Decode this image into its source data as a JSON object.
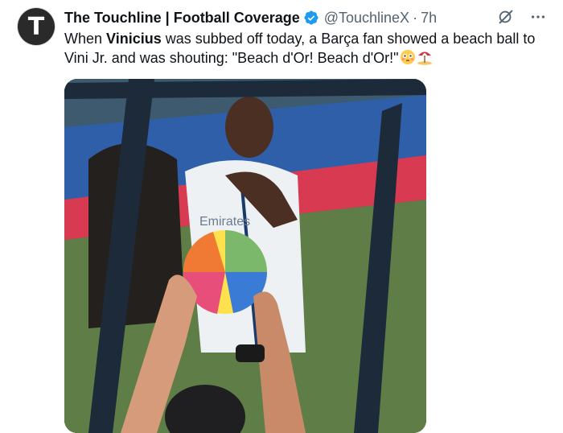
{
  "account": {
    "display_name": "The Touchline | Football Coverage",
    "handle": "@TouchlineX",
    "separator": "·",
    "time": "7h",
    "avatar_letter": "T"
  },
  "post": {
    "text_1": "When ",
    "bold_1": "Vinicius",
    "text_2": " was subbed off today, a Barça fan showed a beach ball to Vini Jr. and was shouting: \"Beach d'Or! Beach d'Or!\"",
    "emojis": [
      "flushed-face-emoji",
      "beach-umbrella-emoji"
    ]
  },
  "media": {
    "shirt_sponsor": "Emirates",
    "description_colors": {
      "pitch": "#5c7a45",
      "shirt": "#e9ecef",
      "frame": "#1d2a3a"
    }
  },
  "colors": {
    "text": "#0f1419",
    "muted": "#536471",
    "verified": "#1d9bf0"
  },
  "icons": [
    "verified-badge-icon",
    "grok-icon",
    "more-icon"
  ]
}
